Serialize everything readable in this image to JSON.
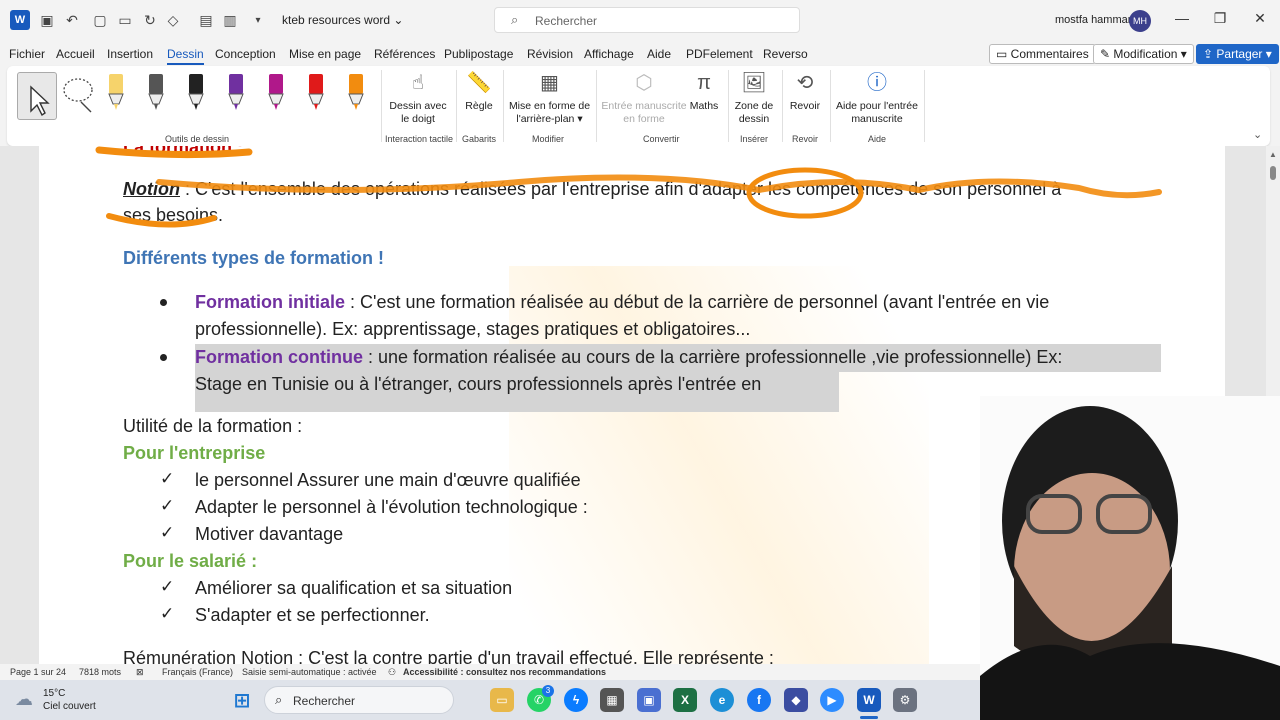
{
  "titlebar": {
    "doc_title": "kteb resources word",
    "search_placeholder": "Rechercher",
    "user_name": "mostfa hammami",
    "user_initials": "MH"
  },
  "tabs": [
    "Fichier",
    "Accueil",
    "Insertion",
    "Dessin",
    "Conception",
    "Mise en page",
    "Références",
    "Publipostage",
    "Révision",
    "Affichage",
    "Aide",
    "PDFelement",
    "Reverso"
  ],
  "active_tab": "Dessin",
  "tab_actions": {
    "comments": "Commentaires",
    "editing": "Modification",
    "share": "Partager"
  },
  "ribbon": {
    "groups": {
      "drawing_tools": "Outils de dessin",
      "touch": "Interaction tactile",
      "templates": "Gabarits",
      "modify": "Modifier",
      "convert": "Convertir",
      "insert": "Insérer",
      "review": "Revoir",
      "help": "Aide"
    },
    "items": {
      "draw_finger": "Dessin avec le doigt",
      "ruler": "Règle",
      "background": "Mise en forme de l'arrière-plan",
      "ink_to_shape": "Entrée manuscrite en forme",
      "math": "Maths",
      "canvas": "Zone de dessin",
      "replay": "Revoir",
      "ink_help": "Aide pour l'entrée manuscrite"
    },
    "pen_colors": [
      "#f6d36b",
      "#555555",
      "#222222",
      "#7030a0",
      "#b0188a",
      "#e01a1a",
      "#f28c0f"
    ]
  },
  "document": {
    "partial_heading": "La formation :",
    "notion_label": "Notion",
    "notion_line1": " : C'est l'ensemble des opérations réalisées par l'entreprise afin d'adapter les compétences de son personnel à",
    "notion_line2": "ses besoins.",
    "types_heading": "Différents types de formation !",
    "initial_label": "Formation initiale",
    "initial_line1": " : C'est une formation réalisée au début de la carrière de personnel (avant l'entrée en vie",
    "initial_line2": "professionnelle). Ex: apprentissage, stages pratiques et obligatoires...",
    "continue_label": "Formation continue",
    "continue_line1": " : une formation réalisée au cours de la carrière professionnelle ,vie professionnelle) Ex:",
    "continue_line2": "Stage en Tunisie ou à l'étranger, cours professionnels après l'entrée en",
    "utility_heading": "Utilité de la formation :",
    "company_heading": "Pour l'entreprise",
    "company_items": [
      "le personnel Assurer une main d'œuvre qualifiée",
      "Adapter le personnel à l'évolution technologique :",
      "Motiver davantage"
    ],
    "employee_heading": "Pour le salarié :",
    "employee_items": [
      "Améliorer sa qualification et sa situation",
      "S'adapter et se perfectionner."
    ],
    "partial_bottom": "Rémunération Notion : C'est la contre partie d'un travail effectué. Elle représente :"
  },
  "statusbar": {
    "page": "Page 1 sur 24",
    "words": "7818 mots",
    "language": "Français (France)",
    "autocomplete": "Saisie semi-automatique : activée",
    "accessibility": "Accessibilité : consultez nos recommandations"
  },
  "taskbar": {
    "temperature": "15°C",
    "weather": "Ciel couvert",
    "search": "Rechercher",
    "whatsapp_badge": "3"
  },
  "colors": {
    "accent": "#185abd",
    "heading_blue": "#3f75b5",
    "heading_purple": "#7030a0",
    "heading_green": "#70ad47",
    "ink_orange": "#f28c0f"
  }
}
